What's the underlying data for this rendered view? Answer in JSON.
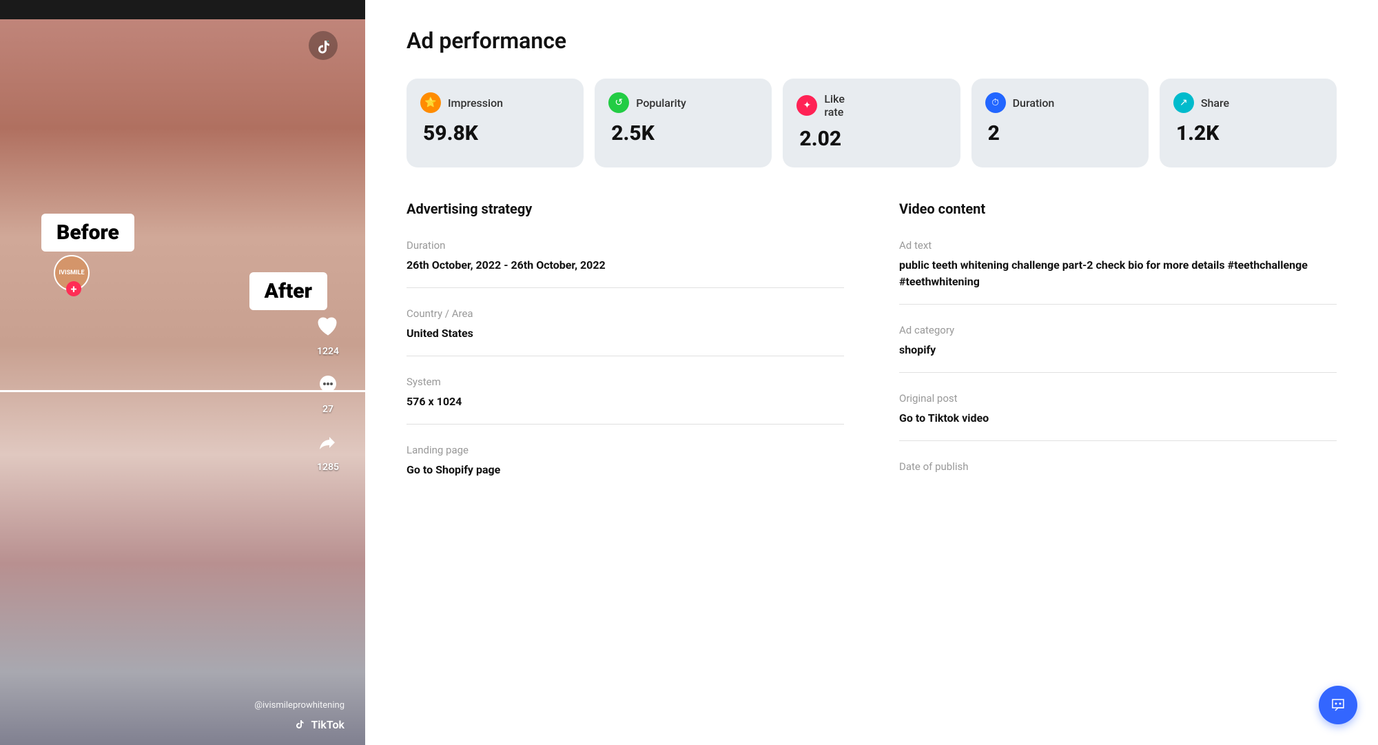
{
  "page": {
    "title": "Ad performance"
  },
  "metrics": [
    {
      "id": "impression",
      "label": "Impression",
      "value": "59.8K",
      "icon_color": "#ff8c00",
      "icon_bg": "#ff8c00",
      "icon_symbol": "⭐"
    },
    {
      "id": "popularity",
      "label": "Popularity",
      "value": "2.5K",
      "icon_color": "#22cc44",
      "icon_bg": "#22cc44",
      "icon_symbol": "♻"
    },
    {
      "id": "like_rate",
      "label": "Like rate",
      "value": "2.02",
      "icon_color": "#ff2255",
      "icon_bg": "#ff2255",
      "icon_symbol": "⚡"
    },
    {
      "id": "duration",
      "label": "Duration",
      "value": "2",
      "icon_color": "#2266ff",
      "icon_bg": "#2266ff",
      "icon_symbol": "⏱"
    },
    {
      "id": "share",
      "label": "Share",
      "value": "1.2K",
      "icon_color": "#00cccc",
      "icon_bg": "#00cccc",
      "icon_symbol": "↗"
    }
  ],
  "advertising_strategy": {
    "section_title": "Advertising strategy",
    "fields": [
      {
        "id": "duration",
        "label": "Duration",
        "value": "26th October, 2022 - 26th October, 2022"
      },
      {
        "id": "country_area",
        "label": "Country / Area",
        "value": "United States"
      },
      {
        "id": "system",
        "label": "System",
        "value": "576 x 1024"
      },
      {
        "id": "landing_page",
        "label": "Landing page",
        "value": "Go to Shopify page"
      }
    ]
  },
  "video_content": {
    "section_title": "Video content",
    "fields": [
      {
        "id": "ad_text",
        "label": "Ad text",
        "value": "public teeth whitening challenge part-2 check bio for more details #teethchallenge #teethwhitening"
      },
      {
        "id": "ad_category",
        "label": "Ad category",
        "value": "shopify"
      },
      {
        "id": "original_post",
        "label": "Original post",
        "value": "Go to Tiktok video"
      },
      {
        "id": "date_of_publish",
        "label": "Date of publish",
        "value": ""
      }
    ]
  },
  "video": {
    "before_label": "Before",
    "after_label": "After",
    "username": "@ivismileprowhitening",
    "user_abbr": "IVISMILE",
    "heart_count": "1224",
    "comment_count": "27",
    "share_count": "1285",
    "tiktok_watermark": "TikTok"
  }
}
